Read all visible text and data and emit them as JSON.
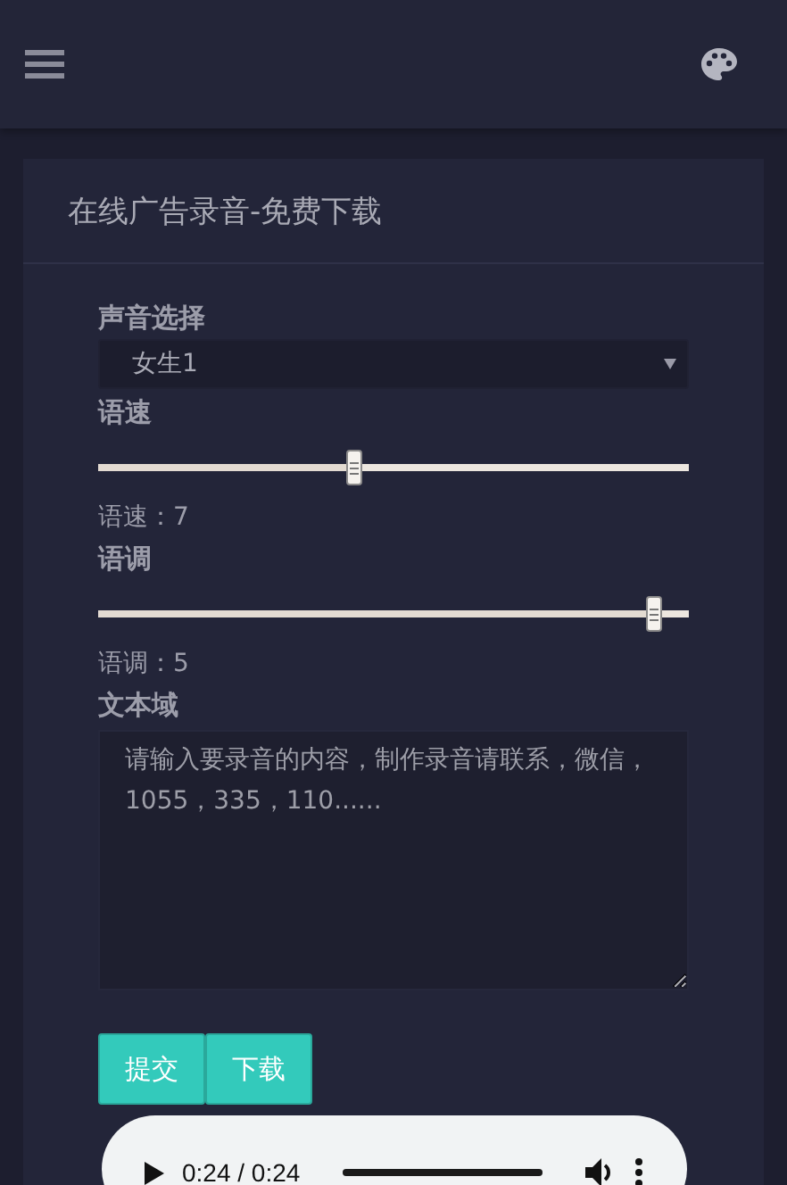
{
  "card": {
    "title": "在线广告录音-免费下载"
  },
  "voice": {
    "label": "声音选择",
    "value": "女生1"
  },
  "sliders": [
    {
      "label": "语速",
      "level": 0.435,
      "reading": "语速：7"
    },
    {
      "label": "语调",
      "level": 0.94,
      "reading": "语调：5"
    }
  ],
  "text_area": {
    "label": "文本域",
    "placeholder": "请输入要录音的内容，制作录音请联系，微信，1055，335，110......"
  },
  "buttons": [
    "提交",
    "下载"
  ],
  "audio": {
    "time": "0:24 / 0:24",
    "level": 1
  }
}
